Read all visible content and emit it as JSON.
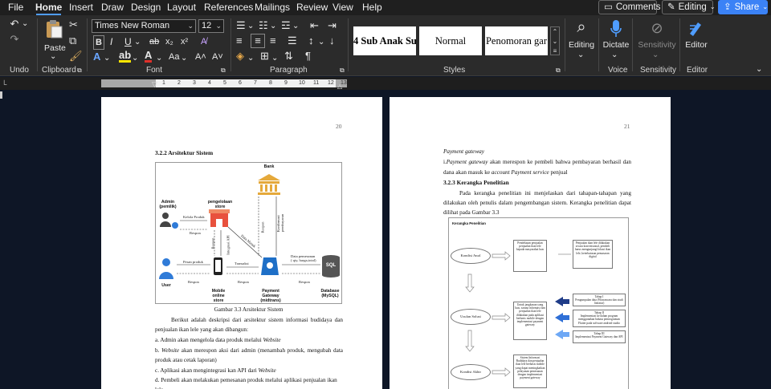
{
  "tabs": {
    "file": "File",
    "home": "Home",
    "insert": "Insert",
    "draw": "Draw",
    "design": "Design",
    "layout": "Layout",
    "references": "References",
    "mailings": "Mailings",
    "review": "Review",
    "view": "View",
    "help": "Help"
  },
  "topbuttons": {
    "comments": "Comments",
    "editing": "Editing",
    "share": "Share"
  },
  "ribbon": {
    "groups": {
      "undo": "Undo",
      "clipboard": "Clipboard",
      "font": "Font",
      "paragraph": "Paragraph",
      "styles": "Styles",
      "voice": "Voice",
      "sensitivity": "Sensitivity",
      "editor": "Editor"
    },
    "paste_label": "Paste",
    "font_name": "Times New Roman",
    "font_size": "12",
    "styles": {
      "s1": "4 Sub Anak Su",
      "s2": "Normal",
      "s3": "Penomoran gar"
    },
    "editing_label": "Editing",
    "dictate_label": "Dictate",
    "sensitivity_label": "Sensitivity",
    "editor_label": "Editor"
  },
  "ruler": {
    "numbers": [
      "1",
      "2",
      "3",
      "4",
      "5",
      "6",
      "7",
      "8",
      "9",
      "10",
      "11",
      "12",
      "13"
    ]
  },
  "page_left": {
    "number": "20",
    "heading": "3.2.2 Arsitektur Sistem",
    "diagram": {
      "bank": "Bank",
      "admin": "Admin\n(pemilik)",
      "store_mgmt": "pengelolaan\nstore",
      "user": "User",
      "mobile": "Mobile\nonline\nstore",
      "gateway": "Payment\nGateway\n(midtrans)",
      "database": "Database\n(MySQL)",
      "sql": "SQL",
      "kelola": "Kelola Produk",
      "respon1": "Respon",
      "pesan": "Pesan produk",
      "respon2": "Respon",
      "transaksi": "Transaksi",
      "respon3": "Respon",
      "respon4": "Respon",
      "data_pemesanan": "Data pemesanan\n( qty, harga,total)",
      "data_masuk": "Data Masuk",
      "respon_v1": "Respon",
      "integrasi": "Integrasi API",
      "respon_v2": "Respon",
      "konfirmasi": "Konfirmasi\npembayaran"
    },
    "caption": "Gambar 3.3 Arsitektur Sistem",
    "para1_a": "Berikut adalah deskripsi dari arsitektur sistem informasi budidaya dan",
    "para1_b": "penjualan ikan lele yang akan dibangun:",
    "item_a_pre": "a. Admin akan mengelola data produk melalui ",
    "item_a_em": "Website",
    "item_b_em": "Website",
    "item_b_rest": " akan merespon aksi dari admin (menambah produk, mengubah data",
    "item_b_2": "produk atau cetak laporan)",
    "item_c_pre": "c. Aplikasi akan mengintegrasi kan API dari ",
    "item_c_em": "Website",
    "item_d": "d. Pembeli akan melakukan pemesanan produk melalui aplikasi penjualan ikan",
    "item_d_2": "lele"
  },
  "page_right": {
    "number": "21",
    "line1": "Payment gateway",
    "line2_pre": "i.",
    "line2_em": "Payment gateway",
    "line2_rest": " akan merespon ke pembeli bahwa pembayaran berhasil dan",
    "line3_pre": "dana akan masuk ke ",
    "line3_em": "account Payment service",
    "line3_rest": " penjual",
    "heading": "3.2.3 Kerangka Penelitian",
    "para_1": "Pada kerangka penelitian ini menjelaskan dari tahapan-tahapan yang",
    "para_2": "dilakukan oleh penulis dalam pengembangan sistem. Kerangka penelitian dapat",
    "para_3": "dilihat pada Gambar 3.3",
    "diagram": {
      "title": "Kerangka Penelitian",
      "kondisi_awal": "Kondisi Awal",
      "usulan": "Usulan Solusi",
      "kondisi_akhir": "Kondisi Akhir",
      "box1": "Pendekatan penjualan penjualan ikan lele kepada masyarakat luas",
      "box2": "Penjualan ikan lele dilakukan secara konvensional, pembeli harus mengunjungi lokasi ikan lele, keterbatasan pemasaran digital",
      "box3": "Untuk jangkauan yang luas, sarana informasi dan penjualan ikan lele dilakukan pada aplikasi berbasis mobile dengan implementasi payment gateway",
      "tahap1": "Tahap I\nPengumpulan data (Wawancara dan studi literatur)",
      "tahap2": "Tahap II\nImplementasi ke dalam program menggunakan bahasa pemrograman Flutter pada software android studio",
      "tahap3": "Tahap III\nImplementasi Payment Gateway dan API",
      "box4": "Sistem Informasi Budidaya dan penjualan ikan lele berbasis mobile yang dapat meningkatkan pelayanan pemesanan dengan implementasi payment gateway"
    }
  },
  "colors": {
    "accent": "#4f9dff",
    "share": "#3b82f6",
    "ribbon_bg": "#2b2b2b",
    "canvas_bg": "#0e1626"
  }
}
